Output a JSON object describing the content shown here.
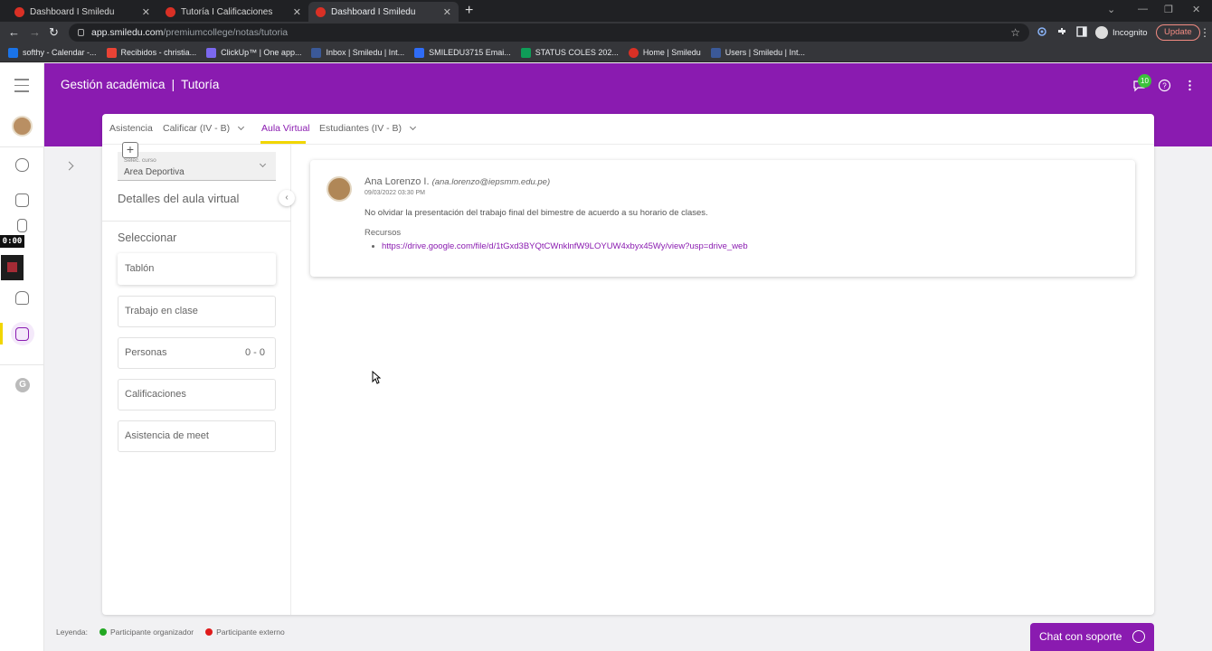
{
  "browser": {
    "tabs": [
      {
        "title": "Dashboard I Smiledu",
        "active": false
      },
      {
        "title": "Tutoría I Calificaciones",
        "active": false
      },
      {
        "title": "Dashboard I Smiledu",
        "active": true
      }
    ],
    "url_host": "app.smiledu.com",
    "url_path": "/premiumcollege/notas/tutoria",
    "profile": "Incognito",
    "update_label": "Update",
    "bookmarks": [
      {
        "label": "softhy - Calendar -...",
        "color": "#1a73e8"
      },
      {
        "label": "Recibidos - christia...",
        "color": "#ea4335"
      },
      {
        "label": "ClickUp™ | One app...",
        "color": "#7b68ee"
      },
      {
        "label": "Inbox | Smiledu | Int...",
        "color": "#3b5998"
      },
      {
        "label": "SMILEDU3715 Emai...",
        "color": "#2f6cf6"
      },
      {
        "label": "STATUS COLES 202...",
        "color": "#0f9d58"
      },
      {
        "label": "Home | Smiledu",
        "color": "#d93025"
      },
      {
        "label": "Users | Smiledu | Int...",
        "color": "#3b5998"
      }
    ]
  },
  "rail": {
    "timer": "0:00"
  },
  "header": {
    "title": "Gestión académica",
    "section": "Tutoría",
    "notifications": "10",
    "brand_color": "#8a1bb0",
    "accent_color": "#f1d600"
  },
  "tabs": {
    "asistencia": "Asistencia",
    "calificar": "Calificar (IV - B)",
    "aula_virtual": "Aula Virtual",
    "estudiantes": "Estudiantes (IV - B)"
  },
  "sidebar": {
    "select_label": "Selec. curso",
    "select_value": "Area Deportiva",
    "title": "Detalles del aula virtual",
    "subtitle": "Seleccionar",
    "items": [
      {
        "label": "Tablón",
        "count": ""
      },
      {
        "label": "Trabajo en clase",
        "count": ""
      },
      {
        "label": "Personas",
        "count": "0 - 0"
      },
      {
        "label": "Calificaciones",
        "count": ""
      },
      {
        "label": "Asistencia de meet",
        "count": ""
      }
    ]
  },
  "post": {
    "author": "Ana Lorenzo I.",
    "email": "(ana.lorenzo@iepsmm.edu.pe)",
    "date": "09/03/2022 03:30 PM",
    "message": "No olvidar la presentación del trabajo final del bimestre de acuerdo a su horario de clases.",
    "resources_label": "Recursos",
    "link": "https://drive.google.com/file/d/1tGxd3BYQtCWnklnfW9LOYUW4xbyx45Wy/view?usp=drive_web"
  },
  "legend": {
    "label": "Leyenda:",
    "items": [
      {
        "label": "Participante organizador",
        "color": "#22a822"
      },
      {
        "label": "Participante externo",
        "color": "#e01b1b"
      }
    ]
  },
  "chat": {
    "label": "Chat con soporte"
  }
}
